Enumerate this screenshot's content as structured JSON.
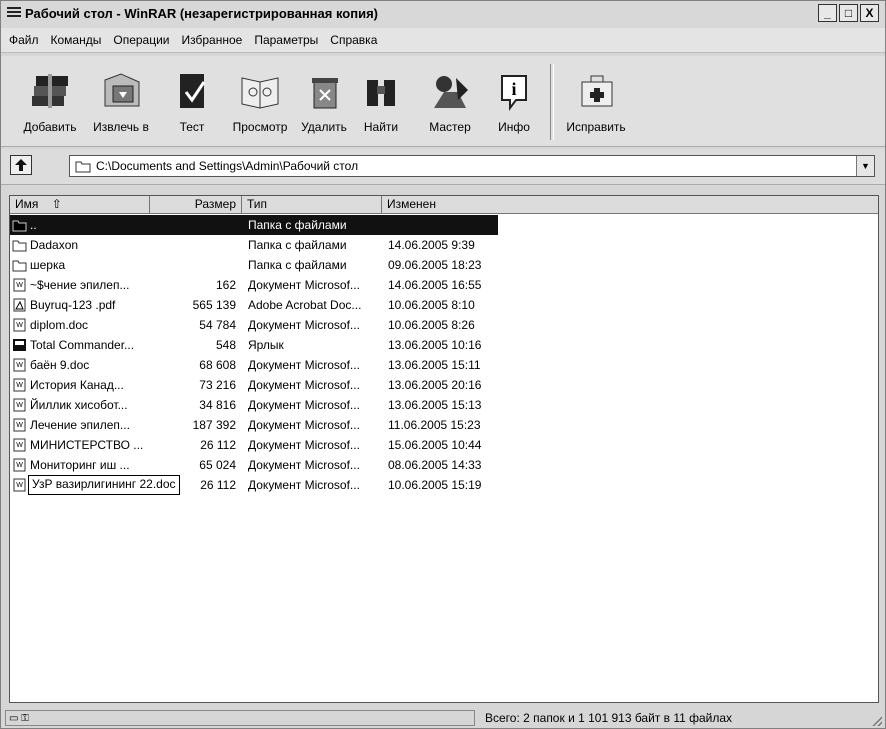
{
  "window": {
    "title": "Рабочий стол - WinRAR (незарегистрированная копия)",
    "controls": {
      "minimize": "_",
      "maximize": "□",
      "close": "X"
    }
  },
  "menu": [
    "Файл",
    "Команды",
    "Операции",
    "Избранное",
    "Параметры",
    "Справка"
  ],
  "toolbar": {
    "add": "Добавить",
    "extract": "Извлечь в",
    "test": "Тест",
    "view": "Просмотр",
    "delete": "Удалить",
    "find": "Найти",
    "wizard": "Мастер",
    "info": "Инфо",
    "repair": "Исправить"
  },
  "address": {
    "path": "C:\\Documents and Settings\\Admin\\Рабочий стол",
    "dropdown_icon": "▼"
  },
  "columns": {
    "name": "Имя",
    "name_sort_icon": "⇧",
    "size": "Размер",
    "type": "Тип",
    "modified": "Изменен"
  },
  "files": [
    {
      "icon": "folder-icon",
      "name": "..",
      "size": "",
      "type": "Папка с файлами",
      "modified": "",
      "selected": true
    },
    {
      "icon": "folder-icon",
      "name": "Dadaxon",
      "size": "",
      "type": "Папка с файлами",
      "modified": "14.06.2005 9:39"
    },
    {
      "icon": "folder-icon",
      "name": "шерка",
      "size": "",
      "type": "Папка с файлами",
      "modified": "09.06.2005 18:23"
    },
    {
      "icon": "word-doc-icon",
      "name": "~$чение эпилеп...",
      "size": "162",
      "type": "Документ Microsof...",
      "modified": "14.06.2005 16:55"
    },
    {
      "icon": "pdf-icon",
      "name": "Buyruq-123 .pdf",
      "size": "565 139",
      "type": "Adobe Acrobat Doc...",
      "modified": "10.06.2005 8:10"
    },
    {
      "icon": "word-doc-icon",
      "name": "diplom.doc",
      "size": "54 784",
      "type": "Документ Microsof...",
      "modified": "10.06.2005 8:26"
    },
    {
      "icon": "shortcut-icon",
      "name": "Total Commander...",
      "size": "548",
      "type": "Ярлык",
      "modified": "13.06.2005 10:16"
    },
    {
      "icon": "word-doc-icon",
      "name": "баён 9.doc",
      "size": "68 608",
      "type": "Документ Microsof...",
      "modified": "13.06.2005 15:11"
    },
    {
      "icon": "word-doc-icon",
      "name": "История Канад...",
      "size": "73 216",
      "type": "Документ Microsof...",
      "modified": "13.06.2005 20:16"
    },
    {
      "icon": "word-doc-icon",
      "name": "Йиллик хисобот...",
      "size": "34 816",
      "type": "Документ Microsof...",
      "modified": "13.06.2005 15:13"
    },
    {
      "icon": "word-doc-icon",
      "name": "Лечение эпилеп...",
      "size": "187 392",
      "type": "Документ Microsof...",
      "modified": "11.06.2005 15:23"
    },
    {
      "icon": "word-doc-icon",
      "name": "МИНИСТЕРСТВО ...",
      "size": "26 112",
      "type": "Документ Microsof...",
      "modified": "15.06.2005 10:44"
    },
    {
      "icon": "word-doc-icon",
      "name": "Мониторинг иш ...",
      "size": "65 024",
      "type": "Документ Microsof...",
      "modified": "08.06.2005 14:33"
    },
    {
      "icon": "word-doc-icon",
      "name": "УзР вазирлигининг 22.doc",
      "size": "26 112",
      "type": "Документ Microsof...",
      "modified": "10.06.2005 15:19",
      "editing": true
    }
  ],
  "status": {
    "icons": "▭ ⚿",
    "summary": "Всего: 2 папок и 1 101 913 байт в 11 файлах"
  }
}
